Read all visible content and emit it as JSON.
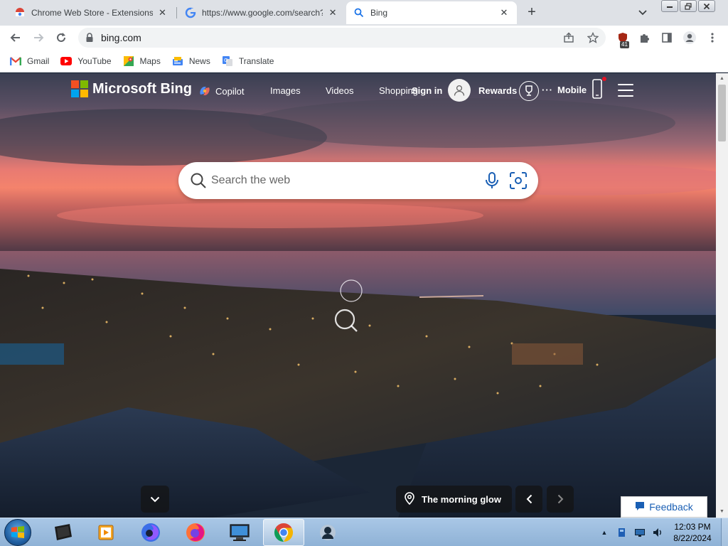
{
  "browser": {
    "tabs": [
      {
        "title": "Chrome Web Store - Extensions o",
        "favicon": "chrome-web-store-icon"
      },
      {
        "title": "https://www.google.com/search?",
        "favicon": "google-icon"
      },
      {
        "title": "Bing",
        "favicon": "search-icon",
        "active": true
      }
    ],
    "new_tab": "+",
    "address": "bing.com",
    "extension_badge": "41",
    "bookmarks": [
      {
        "label": "Gmail",
        "icon": "gmail-icon"
      },
      {
        "label": "YouTube",
        "icon": "youtube-icon"
      },
      {
        "label": "Maps",
        "icon": "maps-icon"
      },
      {
        "label": "News",
        "icon": "news-icon"
      },
      {
        "label": "Translate",
        "icon": "translate-icon"
      }
    ]
  },
  "bing": {
    "brand": "Microsoft Bing",
    "nav": {
      "copilot": "Copilot",
      "images": "Images",
      "videos": "Videos",
      "shopping": "Shopping"
    },
    "sign_in": "Sign in",
    "rewards": "Rewards",
    "mobile": "Mobile",
    "search_placeholder": "Search the web",
    "image_title": "The morning glow",
    "feedback": "Feedback"
  },
  "taskbar": {
    "time": "12:03 PM",
    "date": "8/22/2024"
  },
  "colors": {
    "tabstrip": "#dee1e6",
    "accent_blue": "#1a5fb4",
    "taskbar": "#9fbfe0"
  }
}
